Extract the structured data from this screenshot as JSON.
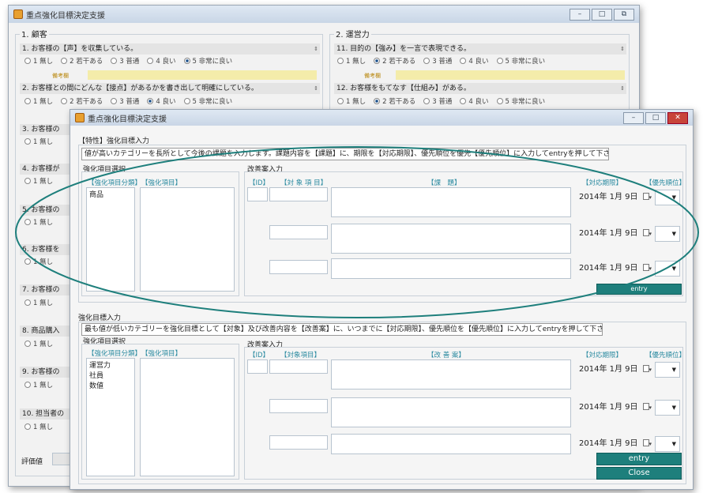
{
  "back_window": {
    "title": "重点強化目標決定支援",
    "section1_heading": "1. 顧客",
    "section2_heading": "2. 運営力",
    "questions_left": [
      "1. お客様の【声】を収集している。",
      "2. お客様との間にどんな【接点】があるかを書き出して明確にしている。",
      "3. お客様の",
      "4. お客様が",
      "5. お客様の",
      "6. お客様を",
      "7. お客様の",
      "8. 商品購入",
      "9. お客様の",
      "10. 担当者の"
    ],
    "questions_right": [
      "11. 目的の【強み】を一言で表現できる。",
      "12. お客様をもてなす【仕組み】がある。"
    ],
    "option_labels": [
      "1 無し",
      "2 若干ある",
      "3 普通",
      "4 良い",
      "5 非常に良い"
    ],
    "short_opt": "1 無し",
    "memo_label": "備考欄",
    "score_label": "評価値"
  },
  "front_window": {
    "title": "重点強化目標決定支援",
    "top_section": {
      "heading": "【特性】強化目標入力",
      "instruction": "値が高いカテゴリーを長所として今後の課題を入力します。課題内容を【課題】に、期限を【対応期限】、優先順位を優先【優先順位】に入力してentryを押して下さい。",
      "selection_title": "強化項目選択",
      "col_class": "【強化項目分類】",
      "col_item": "【強化項目】",
      "class_items": [
        "商品"
      ],
      "entry_title": "改善案入力",
      "col_id": "【ID】",
      "col_target": "【対 象 項 目】",
      "col_issue": "【課　題】",
      "col_deadline": "【対応期限】",
      "col_priority": "【優先順位】",
      "dates": [
        "2014年 1月 9日",
        "2014年 1月 9日",
        "2014年 1月 9日"
      ],
      "entry_button": "entry"
    },
    "bottom_section": {
      "heading": "強化目標入力",
      "instruction": "最も値が低いカテゴリーを強化目標として【対象】及び改善内容を【改善案】に、いつまでに【対応期限】、優先順位を【優先順位】に入力してentryを押して下さい。",
      "selection_title": "強化項目選択",
      "col_class": "【強化項目分類】",
      "col_item": "【強化項目】",
      "class_items": [
        "運営力",
        "社員",
        "数値"
      ],
      "entry_title": "改善案入力",
      "col_id": "【ID】",
      "col_target": "【対象項目】",
      "col_plan": "【改 善 案】",
      "col_deadline": "【対応期限】",
      "col_priority": "【優先順位】",
      "dates": [
        "2014年 1月 9日",
        "2014年 1月 9日",
        "2014年 1月 9日"
      ],
      "entry_button": "entry",
      "close_button": "Close"
    }
  },
  "colors": {
    "accent": "#1e7f7c",
    "ellipse": "#1e7f7c",
    "header_text": "#2a8aa0",
    "memo_bg": "#f4ecaa"
  }
}
